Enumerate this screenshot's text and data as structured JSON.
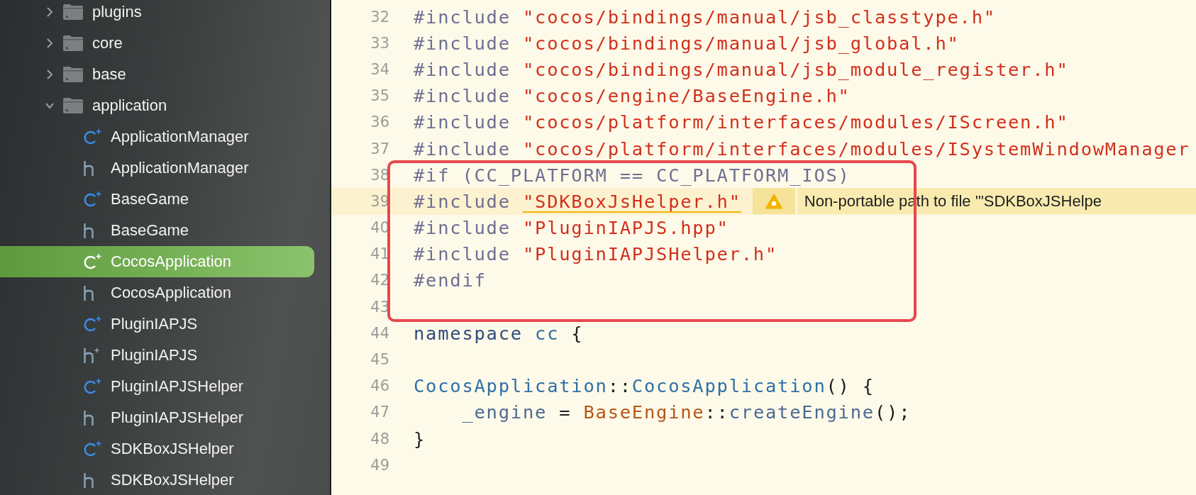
{
  "navigator": {
    "items": [
      {
        "label": "plugins",
        "kind": "folder",
        "expanded": false,
        "selected": false
      },
      {
        "label": "core",
        "kind": "folder",
        "expanded": false,
        "selected": false
      },
      {
        "label": "base",
        "kind": "folder",
        "expanded": false,
        "selected": false
      },
      {
        "label": "application",
        "kind": "folder",
        "expanded": true,
        "selected": false,
        "children": [
          {
            "label": "ApplicationManager",
            "kind": "cpp",
            "selected": false
          },
          {
            "label": "ApplicationManager",
            "kind": "header",
            "selected": false
          },
          {
            "label": "BaseGame",
            "kind": "cpp",
            "selected": false
          },
          {
            "label": "BaseGame",
            "kind": "header",
            "selected": false
          },
          {
            "label": "CocosApplication",
            "kind": "cpp",
            "selected": true
          },
          {
            "label": "CocosApplication",
            "kind": "header",
            "selected": false
          },
          {
            "label": "PluginIAPJS",
            "kind": "cpp",
            "selected": false
          },
          {
            "label": "PluginIAPJS",
            "kind": "cpp-header",
            "selected": false
          },
          {
            "label": "PluginIAPJSHelper",
            "kind": "cpp",
            "selected": false
          },
          {
            "label": "PluginIAPJSHelper",
            "kind": "header",
            "selected": false
          },
          {
            "label": "SDKBoxJSHelper",
            "kind": "cpp",
            "selected": false
          },
          {
            "label": "SDKBoxJSHelper",
            "kind": "header",
            "selected": false
          }
        ]
      }
    ]
  },
  "editor": {
    "lines": [
      {
        "number": "32",
        "current": false,
        "tokens": [
          {
            "text": "#include ",
            "kind": "directive"
          },
          {
            "text": "\"cocos/bindings/manual/jsb_classtype.h\"",
            "kind": "string"
          }
        ]
      },
      {
        "number": "33",
        "current": false,
        "tokens": [
          {
            "text": "#include ",
            "kind": "directive"
          },
          {
            "text": "\"cocos/bindings/manual/jsb_global.h\"",
            "kind": "string"
          }
        ]
      },
      {
        "number": "34",
        "current": false,
        "tokens": [
          {
            "text": "#include ",
            "kind": "directive"
          },
          {
            "text": "\"cocos/bindings/manual/jsb_module_register.h\"",
            "kind": "string"
          }
        ]
      },
      {
        "number": "35",
        "current": false,
        "tokens": [
          {
            "text": "#include ",
            "kind": "directive"
          },
          {
            "text": "\"cocos/engine/BaseEngine.h\"",
            "kind": "string"
          }
        ]
      },
      {
        "number": "36",
        "current": false,
        "tokens": [
          {
            "text": "#include ",
            "kind": "directive"
          },
          {
            "text": "\"cocos/platform/interfaces/modules/IScreen.h\"",
            "kind": "string"
          }
        ]
      },
      {
        "number": "37",
        "current": false,
        "tokens": [
          {
            "text": "#include ",
            "kind": "directive"
          },
          {
            "text": "\"cocos/platform/interfaces/modules/ISystemWindowManager",
            "kind": "string"
          }
        ]
      },
      {
        "number": "38",
        "current": false,
        "tokens": [
          {
            "text": "#if (CC_PLATFORM == CC_PLATFORM_IOS)",
            "kind": "directive"
          }
        ]
      },
      {
        "number": "39",
        "current": true,
        "tokens": [
          {
            "text": "#include ",
            "kind": "directive"
          },
          {
            "text": "\"SDKBoxJsHelper.h\"",
            "kind": "flagged-string"
          }
        ],
        "issue": {
          "message": "Non-portable path to file '\"SDKBoxJSHelpe"
        }
      },
      {
        "number": "40",
        "current": false,
        "tokens": [
          {
            "text": "#include ",
            "kind": "directive"
          },
          {
            "text": "\"PluginIAPJS.hpp\"",
            "kind": "string"
          }
        ]
      },
      {
        "number": "41",
        "current": false,
        "tokens": [
          {
            "text": "#include ",
            "kind": "directive"
          },
          {
            "text": "\"PluginIAPJSHelper.h\"",
            "kind": "string"
          }
        ]
      },
      {
        "number": "42",
        "current": false,
        "tokens": [
          {
            "text": "#endif",
            "kind": "directive"
          }
        ]
      },
      {
        "number": "43",
        "current": false
      },
      {
        "number": "44",
        "current": false,
        "tokens": [
          {
            "text": "namespace ",
            "kind": "keyword"
          },
          {
            "text": "cc",
            "kind": "name"
          },
          {
            "text": " {",
            "kind": "plain"
          }
        ]
      },
      {
        "number": "45",
        "current": false
      },
      {
        "number": "46",
        "current": false,
        "tokens": [
          {
            "text": "CocosApplication",
            "kind": "name"
          },
          {
            "text": "::",
            "kind": "plain"
          },
          {
            "text": "CocosApplication",
            "kind": "name"
          },
          {
            "text": "() {",
            "kind": "plain"
          }
        ]
      },
      {
        "number": "47",
        "current": false,
        "tokens": [
          {
            "text": "    _engine",
            "kind": "member"
          },
          {
            "text": " = ",
            "kind": "plain"
          },
          {
            "text": "BaseEngine",
            "kind": "type"
          },
          {
            "text": "::",
            "kind": "plain"
          },
          {
            "text": "createEngine",
            "kind": "member"
          },
          {
            "text": "();",
            "kind": "plain"
          }
        ]
      },
      {
        "number": "48",
        "current": false,
        "tokens": [
          {
            "text": "}",
            "kind": "plain"
          }
        ]
      },
      {
        "number": "49",
        "current": false
      }
    ]
  }
}
